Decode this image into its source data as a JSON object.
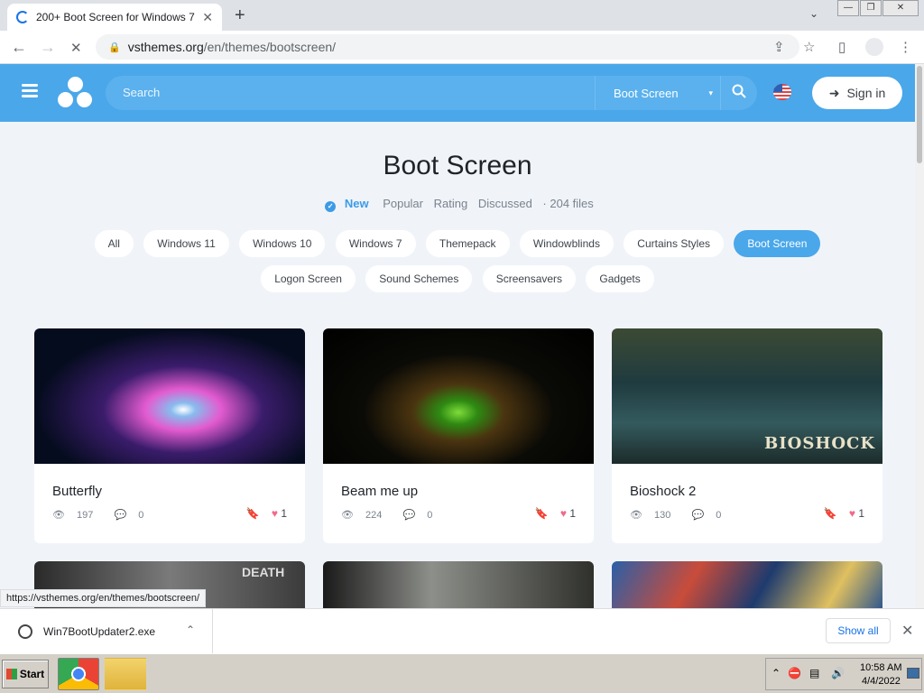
{
  "browser": {
    "tab_title": "200+ Boot Screen for Windows 7",
    "tab_close": "✕",
    "new_tab": "+",
    "tab_dropdown": "⌄",
    "url_host": "vsthemes.org",
    "url_path": "/en/themes/bootscreen/",
    "win_minimize": "—",
    "win_restore": "❐",
    "win_close": "✕",
    "back": "←",
    "forward": "→",
    "reload_stop": "✕",
    "lock": "🔒",
    "share": "⇪",
    "bookmark": "☆",
    "sidepanel": "▯",
    "menu": "⋮"
  },
  "site": {
    "search_placeholder": "Search",
    "category": "Boot Screen",
    "category_caret": "▾",
    "signin_label": "Sign in",
    "signin_icon": "➜"
  },
  "page": {
    "title": "Boot Screen",
    "check": "✓",
    "sort": {
      "new": "New",
      "popular": "Popular",
      "rating": "Rating",
      "discussed": "Discussed",
      "files": "· 204 files"
    },
    "chips_row1": [
      "All",
      "Windows 11",
      "Windows 10",
      "Windows 7",
      "Themepack",
      "Windowblinds",
      "Curtains Styles",
      "Boot Screen"
    ],
    "chips_row2": [
      "Logon Screen",
      "Sound Schemes",
      "Screensavers",
      "Gadgets"
    ],
    "active_chip": "Boot Screen",
    "eye": "👁",
    "comment": "💬",
    "bookmark": "🔖",
    "heart": "♥",
    "cards": [
      {
        "name": "Butterfly",
        "views": "197",
        "comments": "0",
        "likes": "1"
      },
      {
        "name": "Beam me up",
        "views": "224",
        "comments": "0",
        "likes": "1"
      },
      {
        "name": "Bioshock 2",
        "views": "130",
        "comments": "0",
        "likes": "1"
      }
    ],
    "thumb_text": "BIOSHOCK",
    "row2_text": "DEATH"
  },
  "status_url": "https://vsthemes.org/en/themes/bootscreen/",
  "downloads": {
    "filename": "Win7BootUpdater2.exe",
    "caret": "⌃",
    "show_all": "Show all",
    "close": "✕"
  },
  "taskbar": {
    "start": "Start",
    "time": "10:58 AM",
    "date": "4/4/2022",
    "tray_icons": [
      "⌃",
      "⛔",
      "▤",
      "🔊"
    ]
  }
}
